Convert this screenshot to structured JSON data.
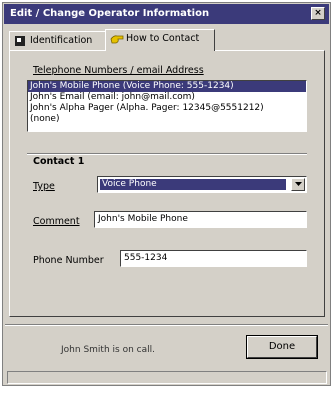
{
  "window": {
    "title": "Edit / Change Operator Information",
    "close_label": "×"
  },
  "tabs": [
    {
      "label": "Identification",
      "icon": "id-card-icon"
    },
    {
      "label": "How to Contact",
      "icon": "contact-hand-icon"
    }
  ],
  "contact_list": {
    "label": "Telephone Numbers / email Address",
    "items": [
      "John's Mobile Phone (Voice Phone: 555-1234)",
      "John's Email (email: john@mail.com)",
      "John's Alpha Pager (Alpha. Pager: 12345@5551212)",
      "(none)"
    ],
    "selected_index": 0
  },
  "contact_group": {
    "title": "Contact 1",
    "type_label": "Type",
    "type_value": "Voice Phone",
    "comment_label": "Comment",
    "comment_value": "John's Mobile Phone",
    "phone_label": "Phone Number",
    "phone_value": "555-1234"
  },
  "footer": {
    "status_text": "John Smith is on call.",
    "done_label": "Done"
  },
  "colors": {
    "selection": "#3b3a7a",
    "face": "#d4d0c8"
  }
}
